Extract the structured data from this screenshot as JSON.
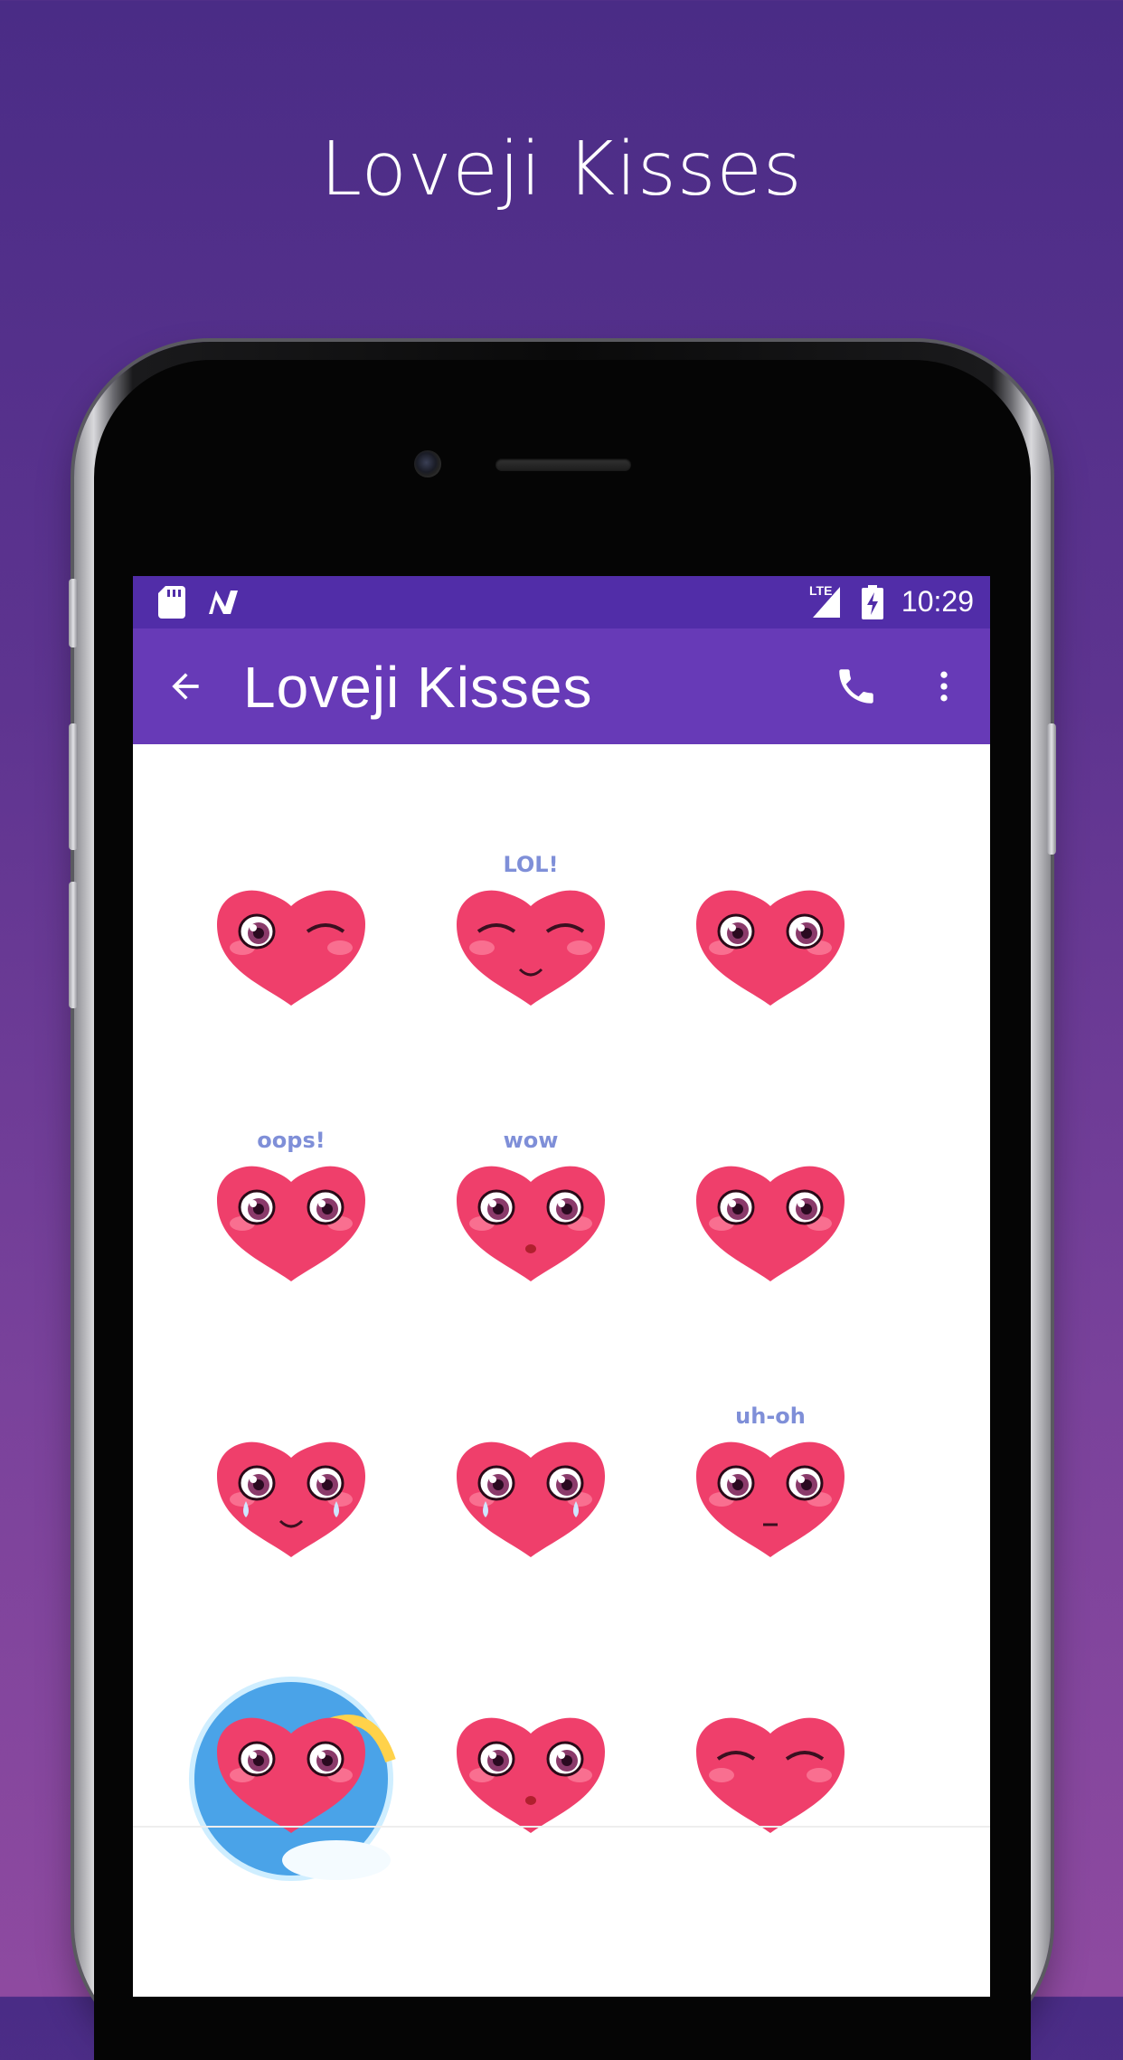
{
  "promo": {
    "title": "Loveji Kisses"
  },
  "status_bar": {
    "network": "LTE",
    "time": "10:29"
  },
  "app_bar": {
    "title": "Loveji Kisses"
  },
  "stickers": [
    {
      "caption": "",
      "name": "winking-heart"
    },
    {
      "caption": "LOL!",
      "name": "lol-heart"
    },
    {
      "caption": "",
      "name": "blushing-heart"
    },
    {
      "caption": "oops!",
      "name": "oops-heart"
    },
    {
      "caption": "wow",
      "name": "wow-heart"
    },
    {
      "caption": "",
      "name": "shy-heart"
    },
    {
      "caption": "",
      "name": "crying-smile-heart"
    },
    {
      "caption": "",
      "name": "crying-heart"
    },
    {
      "caption": "uh-oh",
      "name": "uh-oh-heart"
    },
    {
      "caption": "",
      "name": "rainbow-heart"
    },
    {
      "caption": "",
      "name": "surprised-heart"
    },
    {
      "caption": "",
      "name": "content-heart"
    }
  ],
  "colors": {
    "status_bar": "#512da8",
    "app_bar": "#673ab7",
    "heart": "#ef3f6b",
    "caption": "#7f8fd8"
  }
}
